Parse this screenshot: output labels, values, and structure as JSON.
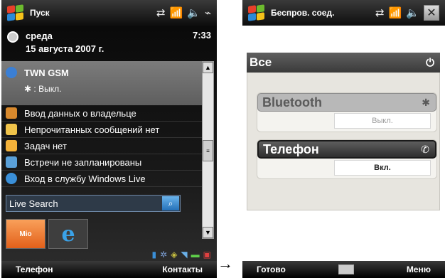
{
  "left": {
    "status": {
      "title": "Пуск"
    },
    "date": {
      "weekday": "среда",
      "date": "15 августа 2007 г.",
      "time": "7:33"
    },
    "wifi": {
      "title": "TWN GSM",
      "bluetooth": ": Выкл."
    },
    "items": [
      {
        "label": "Ввод данных о владельце",
        "icon_color": "#d8892d"
      },
      {
        "label": "Непрочитанных сообщений нет",
        "icon_color": "#f0c34a"
      },
      {
        "label": "Задач нет",
        "icon_color": "#f4b23a"
      },
      {
        "label": "Встречи не запланированы",
        "icon_color": "#5aa0d8"
      },
      {
        "label": "Вход в службу Windows Live",
        "icon_color": "#3a8fd8"
      }
    ],
    "search": {
      "label": "Live Search"
    },
    "tiles": {
      "mio": "Mio"
    },
    "softkeys": {
      "left": "Телефон",
      "right": "Контакты"
    }
  },
  "right": {
    "status": {
      "title": "Беспров. соед."
    },
    "all": {
      "label": "Все"
    },
    "bluetooth": {
      "label": "Bluetooth",
      "state": "Выкл."
    },
    "phone": {
      "label": "Телефон",
      "state": "Вкл."
    },
    "softkeys": {
      "left": "Готово",
      "right": "Меню"
    }
  }
}
